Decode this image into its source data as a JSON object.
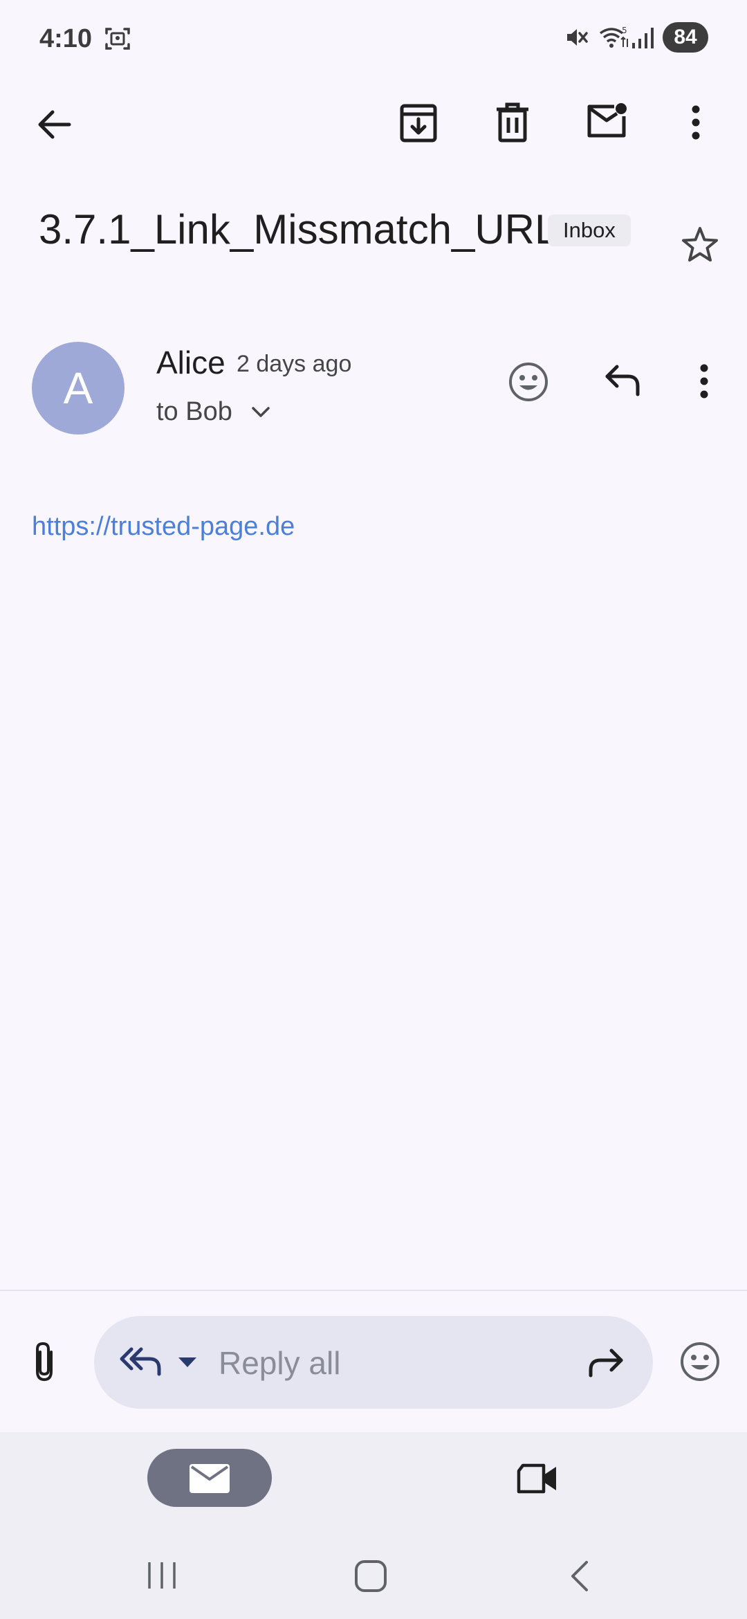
{
  "status_bar": {
    "time": "4:10",
    "battery": "84"
  },
  "toolbar": {
    "back_icon": "arrow-left-icon",
    "archive_icon": "archive-icon",
    "delete_icon": "trash-icon",
    "mark_unread_icon": "mail-unread-icon",
    "more_icon": "more-vert-icon"
  },
  "email": {
    "subject": "3.7.1_Link_Missmatch_URL",
    "label": "Inbox",
    "sender": {
      "initial": "A",
      "name": "Alice",
      "time": "2 days ago",
      "recipient_line": "to Bob"
    },
    "body_link": "https://trusted-page.de"
  },
  "reply_bar": {
    "placeholder": "Reply all"
  },
  "colors": {
    "background": "#f9f7fd",
    "avatar": "#9ea9d8",
    "link": "#4b7fd8",
    "reply_pill": "#e4e5f0",
    "bottom_area": "#efeef4",
    "mail_tab_active": "#6e7283"
  }
}
